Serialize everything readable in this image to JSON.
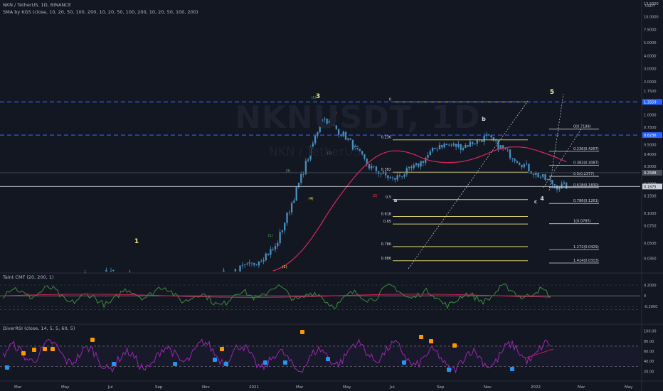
{
  "header": {
    "symbol_line": "NKN / TetherUS, 1D, BINANCE",
    "indicator_line": "SMA by KGS (close, 10, 20, 50, 100, 200, 10, 20, 50, 100, 200, 10, 20, 50, 100, 200)"
  },
  "watermark": {
    "symbol": "NKNUSDT, 1D",
    "name": "NKN / TetherUS"
  },
  "colors": {
    "background": "#131722",
    "candle": "#4a8fbf",
    "sma": "#e0245e",
    "fib": "#d8cc6e",
    "blue_level": "#2962ff",
    "cmf": "#3c8c3c",
    "rsi": "#9c27b0",
    "bull_label": "#2196f3",
    "bear_label": "#ff9800"
  },
  "chart_data": [
    {
      "type": "line",
      "title": "NKN / TetherUS, 1D, BINANCE",
      "price_scale": "log",
      "currency": "USDT",
      "ylim": [
        0.0265,
        1.75
      ],
      "y_ticks": [
        "1.7500",
        "1.0000",
        "0.7500",
        "0.5000",
        "0.4000",
        "0.3000",
        "0.2000",
        "0.1500",
        "0.1000",
        "0.0750",
        "0.0500",
        "0.0350"
      ],
      "right_ticks_upper": [
        "13.5000",
        "10.0000",
        "7.5000",
        "5.0000",
        "4.0000",
        "3.0000",
        "2.0000"
      ],
      "price_labels": [
        "1.3559",
        "0.6236",
        "0.2588",
        "0.1875"
      ],
      "price_levels": [
        1.3559,
        0.6236,
        0.2588,
        0.1875
      ],
      "series": [
        {
          "x": [
            "2020-03",
            "2020-05",
            "2020-07",
            "2020-09",
            "2020-11",
            "2021-01",
            "2021-02",
            "2021-03",
            "2021-04",
            "2021-05",
            "2021-06",
            "2021-07",
            "2021-08",
            "2021-09",
            "2021-10",
            "2021-11",
            "2021-12",
            "2022-01",
            "2022-02"
          ],
          "values": [
            0.02,
            0.022,
            0.025,
            0.022,
            0.021,
            0.03,
            0.045,
            0.2,
            0.95,
            0.6,
            0.3,
            0.22,
            0.3,
            0.5,
            0.48,
            0.6,
            0.4,
            0.26,
            0.19
          ]
        }
      ],
      "fib_retracement": {
        "labels": [
          "0",
          "0.236",
          "0.382",
          "0.5",
          "0.618",
          "0.65",
          "0.786",
          "0.886"
        ],
        "prices": [
          1.3559,
          0.558,
          0.262,
          0.138,
          0.093,
          0.078,
          0.046,
          0.033
        ]
      },
      "fib_extension": {
        "labels": [
          "0(0.7199)",
          "0.236(0.4267)",
          "0.382(0.3087)",
          "0.5(0.2377)",
          "0.618(0.1830)",
          "0.786(0.1261)",
          "1(0.0785)",
          "1.272(0.0429)",
          "1.414(0.0313)"
        ],
        "prices": [
          0.7199,
          0.4267,
          0.3087,
          0.2377,
          0.183,
          0.1261,
          0.0785,
          0.0429,
          0.0313
        ]
      },
      "wave_labels": [
        "1",
        "3",
        "5",
        "4",
        "a",
        "b",
        "c",
        "(1)",
        "(2)",
        "(3)",
        "(4)",
        "(5)",
        "(1)",
        "(2)"
      ],
      "x_ticks": [
        "Mar",
        "May",
        "Jul",
        "Sep",
        "Nov",
        "2021",
        "Mar",
        "May",
        "Jul",
        "Sep",
        "Nov",
        "2022",
        "Mar",
        "May",
        "Jul"
      ]
    },
    {
      "type": "line",
      "title": "Taint CMF (20, 200, 1)",
      "ylim": [
        -0.45,
        0.32
      ],
      "y_ticks": [
        "0.2000",
        "0",
        "-0.2000"
      ],
      "y_tick_values": [
        0.2,
        0,
        -0.2
      ]
    },
    {
      "type": "line",
      "title": "DiverRSI (close, 14, 5, 5, 60, 5)",
      "ylim": [
        15,
        105
      ],
      "y_ticks": [
        "100.00",
        "80.00",
        "60.00",
        "40.00",
        "20.00"
      ],
      "y_tick_values": [
        100,
        80,
        60,
        40,
        20
      ],
      "levels": [
        70,
        30
      ]
    }
  ]
}
